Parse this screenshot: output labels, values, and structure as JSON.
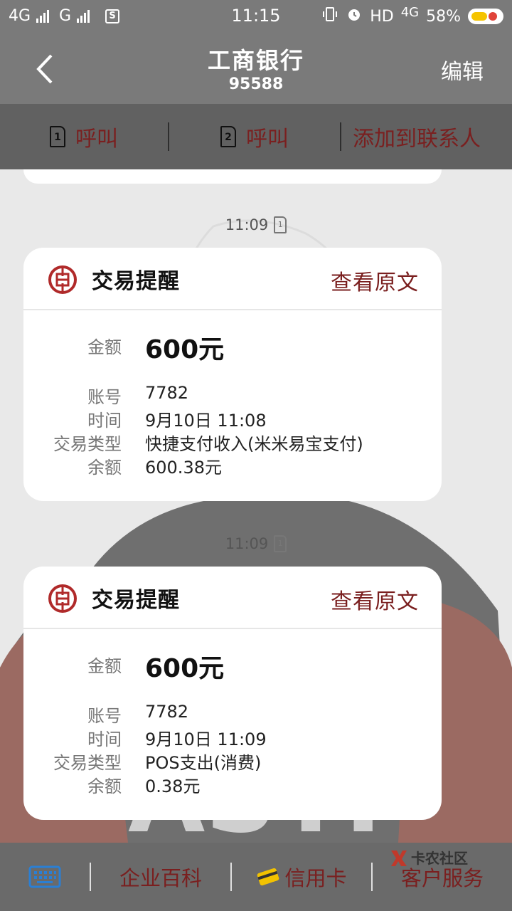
{
  "status_bar": {
    "sim1_network": "4G",
    "sim2_network": "G",
    "sim_badge": "S",
    "time": "11:15",
    "hd_label": "HD",
    "data_network": "4G",
    "battery_percent": "58%",
    "battery_level": 0.58
  },
  "header": {
    "title": "工商银行",
    "subtitle": "95588",
    "edit_label": "编辑"
  },
  "action_bar": {
    "call1_sim": "1",
    "call1_label": "呼叫",
    "call2_sim": "2",
    "call2_label": "呼叫",
    "add_contact_label": "添加到联系人"
  },
  "messages": [
    {
      "timestamp": "11:09",
      "sim": "1",
      "title": "交易提醒",
      "view_original": "查看原文",
      "amount_label": "金额",
      "amount_value": "600元",
      "account_label": "账号",
      "account_value": "7782",
      "time_label": "时间",
      "time_value": "9月10日 11:08",
      "type_label": "交易类型",
      "type_value": "快捷支付收入(米米易宝支付)",
      "balance_label": "余额",
      "balance_value": "600.38元"
    },
    {
      "timestamp": "11:09",
      "sim": "1",
      "title": "交易提醒",
      "view_original": "查看原文",
      "amount_label": "金额",
      "amount_value": "600元",
      "account_label": "账号",
      "account_value": "7782",
      "time_label": "时间",
      "time_value": "9月10日 11:09",
      "type_label": "交易类型",
      "type_value": "POS支出(消费)",
      "balance_label": "余额",
      "balance_value": "0.38元"
    }
  ],
  "bottom_bar": {
    "keyboard_icon": "keyboard-icon",
    "item1": "企业百科",
    "item2": "信用卡",
    "item3": "客户服务"
  },
  "watermark": "卡农社区",
  "colors": {
    "accent_red": "#7a1f1f",
    "header_gray": "#7a7a7a",
    "actionbar_gray": "#616161",
    "keyboard_blue": "#2a7fd4",
    "card_gold": "#f2c200"
  }
}
